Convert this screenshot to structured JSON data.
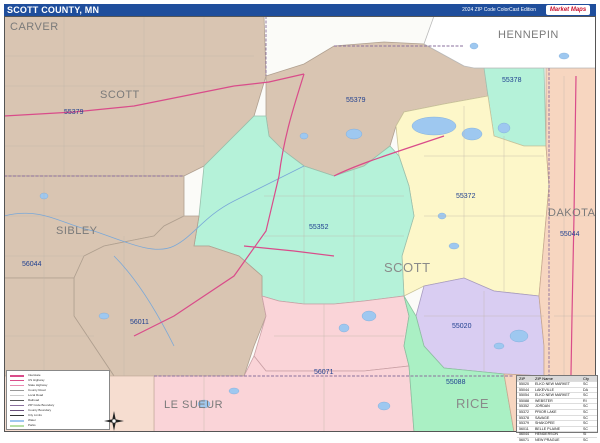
{
  "header": {
    "title": "SCOTT COUNTY, MN",
    "edition": "2024 ZIP Code ColorCast Edition",
    "logo": "Market Maps"
  },
  "colors": {
    "tan": "#d9c5b2",
    "mint": "#b5f2d9",
    "yellow": "#fdf7c9",
    "green": "#aaf0c4",
    "pink": "#fad4d8",
    "lavender": "#d9cdf2",
    "peach": "#f7d6c0",
    "lightpink": "#f8dfe3",
    "water": "#9ec8f0",
    "highway": "#d94c8a",
    "title_blue": "#1f4e9c"
  },
  "counties": {
    "carver": "CARVER",
    "hennepin": "HENNEPIN",
    "scott_nw": "SCOTT",
    "sibley": "SIBLEY",
    "scott_center": "SCOTT",
    "dakota": "DAKOTA",
    "le_sueur": "LE SUEUR",
    "rice": "RICE"
  },
  "zip_labels": {
    "z55378": "55378",
    "z55379_a": "55379",
    "z55379_b": "55379",
    "z55372": "55372",
    "z55352": "55352",
    "z55044": "55044",
    "z56044": "56044",
    "z56011": "56011",
    "z55020": "55020",
    "z56071": "56071",
    "z55088": "55088"
  },
  "legend": {
    "items": [
      "Interstate",
      "US Highway",
      "State Highway",
      "County Road",
      "Local Road",
      "Railroad",
      "ZIP Code Boundary",
      "County Boundary",
      "City Limits",
      "Water",
      "Parks"
    ]
  },
  "zip_table": {
    "headers": [
      "ZIP",
      "ZIP Name",
      "Cty"
    ],
    "rows": [
      [
        "55020",
        "ELKO NEW MARKET",
        "SC"
      ],
      [
        "55044",
        "LAKEVILLE",
        "DA"
      ],
      [
        "55054",
        "ELKO NEW MARKET",
        "SC"
      ],
      [
        "55088",
        "WEBSTER",
        "RI"
      ],
      [
        "55352",
        "JORDAN",
        "SC"
      ],
      [
        "55372",
        "PRIOR LAKE",
        "SC"
      ],
      [
        "55378",
        "SAVAGE",
        "SC"
      ],
      [
        "55379",
        "SHAKOPEE",
        "SC"
      ],
      [
        "56011",
        "BELLE PLAINE",
        "SC"
      ],
      [
        "56044",
        "HENDERSON",
        "SI"
      ],
      [
        "56071",
        "NEW PRAGUE",
        "SC"
      ]
    ]
  }
}
